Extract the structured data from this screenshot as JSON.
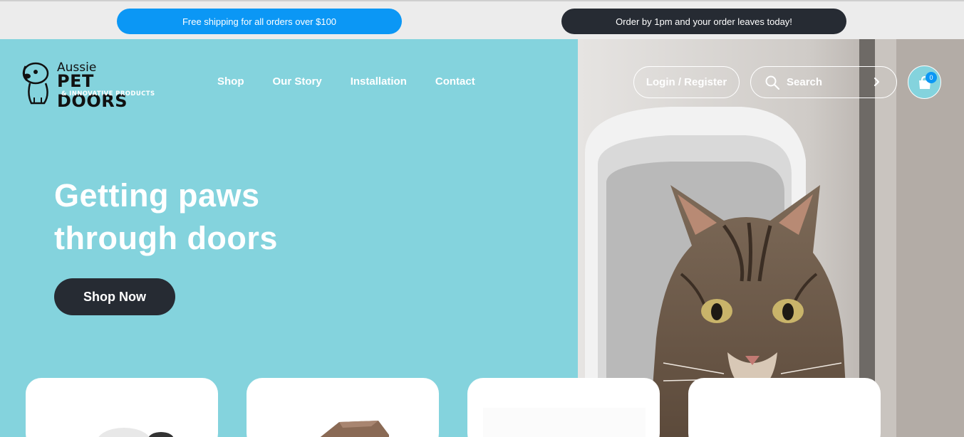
{
  "announcements": {
    "shipping": "Free shipping for all orders over $100",
    "dispatch": "Order by 1pm and your order leaves today!"
  },
  "logo": {
    "line1": "Aussie",
    "line2": "PET DOORS",
    "line3": "& INNOVATIVE PRODUCTS"
  },
  "nav": {
    "items": [
      {
        "label": "Shop"
      },
      {
        "label": "Our Story"
      },
      {
        "label": "Installation"
      },
      {
        "label": "Contact"
      }
    ]
  },
  "header": {
    "login_label": "Login / Register",
    "search_placeholder": "Search",
    "cart_count": "0"
  },
  "hero": {
    "headline_line1": "Getting paws",
    "headline_line2": "through doors",
    "cta_label": "Shop Now"
  },
  "icons": {
    "search": "search-icon",
    "arrow": "chevron-right-icon",
    "cart": "shopping-bag-icon"
  },
  "colors": {
    "hero_bg": "#84d3dd",
    "accent_blue": "#0b97f5",
    "dark": "#262b33"
  }
}
